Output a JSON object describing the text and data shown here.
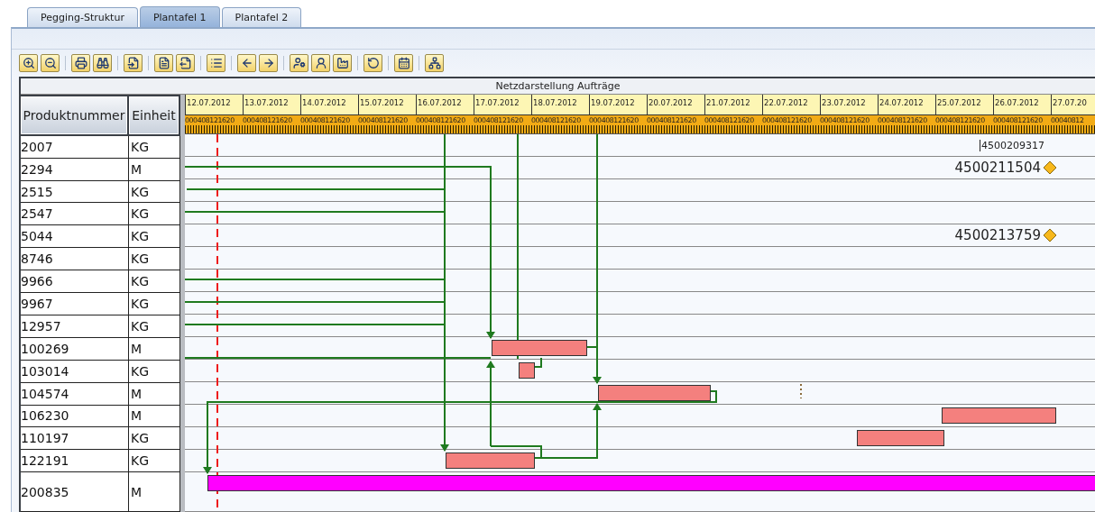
{
  "tabs": [
    {
      "label": "Pegging-Struktur",
      "selected": false
    },
    {
      "label": "Plantafel 1",
      "selected": true
    },
    {
      "label": "Plantafel 2",
      "selected": false
    }
  ],
  "table": {
    "title": "Netzdarstellung Aufträge",
    "columns": [
      "Produktnummer",
      "Einheit"
    ],
    "dates": [
      {
        "label": "12.07.2012",
        "hours": "000408121620"
      },
      {
        "label": "13.07.2012",
        "hours": "000408121620"
      },
      {
        "label": "14.07.2012",
        "hours": "000408121620"
      },
      {
        "label": "15.07.2012",
        "hours": "000408121620"
      },
      {
        "label": "16.07.2012",
        "hours": "000408121620"
      },
      {
        "label": "17.07.2012",
        "hours": "000408121620"
      },
      {
        "label": "18.07.2012",
        "hours": "000408121620"
      },
      {
        "label": "19.07.2012",
        "hours": "000408121620"
      },
      {
        "label": "20.07.2012",
        "hours": "000408121620"
      },
      {
        "label": "21.07.2012",
        "hours": "000408121620"
      },
      {
        "label": "22.07.2012",
        "hours": "000408121620"
      },
      {
        "label": "23.07.2012",
        "hours": "000408121620"
      },
      {
        "label": "24.07.2012",
        "hours": "000408121620"
      },
      {
        "label": "25.07.2012",
        "hours": "000408121620"
      },
      {
        "label": "26.07.2012",
        "hours": "000408121620"
      },
      {
        "label": "27.07.20",
        "hours": "00040812"
      }
    ],
    "rows": [
      {
        "product": "2007",
        "unit": "KG",
        "order": {
          "number": "4500209317",
          "kind": "plain"
        }
      },
      {
        "product": "2294",
        "unit": "M",
        "order": {
          "number": "4500211504",
          "kind": "milestone"
        }
      },
      {
        "product": "2515",
        "unit": "KG"
      },
      {
        "product": "2547",
        "unit": "KG"
      },
      {
        "product": "5044",
        "unit": "KG",
        "order": {
          "number": "4500213759",
          "kind": "milestone"
        }
      },
      {
        "product": "8746",
        "unit": "KG"
      },
      {
        "product": "9966",
        "unit": "KG"
      },
      {
        "product": "9967",
        "unit": "KG"
      },
      {
        "product": "12957",
        "unit": "KG"
      },
      {
        "product": "100269",
        "unit": "M",
        "bar": {
          "color": "#f4807e"
        }
      },
      {
        "product": "103014",
        "unit": "KG",
        "bar": {
          "color": "#f4807e"
        }
      },
      {
        "product": "104574",
        "unit": "M",
        "bar": {
          "color": "#f4807e"
        }
      },
      {
        "product": "106230",
        "unit": "M",
        "bar": {
          "color": "#f4807e"
        }
      },
      {
        "product": "110197",
        "unit": "KG",
        "bar": {
          "color": "#f4807e"
        }
      },
      {
        "product": "122191",
        "unit": "KG",
        "bar": {
          "color": "#f4807e"
        }
      },
      {
        "product": "200835",
        "unit": "M",
        "bar": {
          "color": "#ff00ff"
        }
      }
    ]
  }
}
